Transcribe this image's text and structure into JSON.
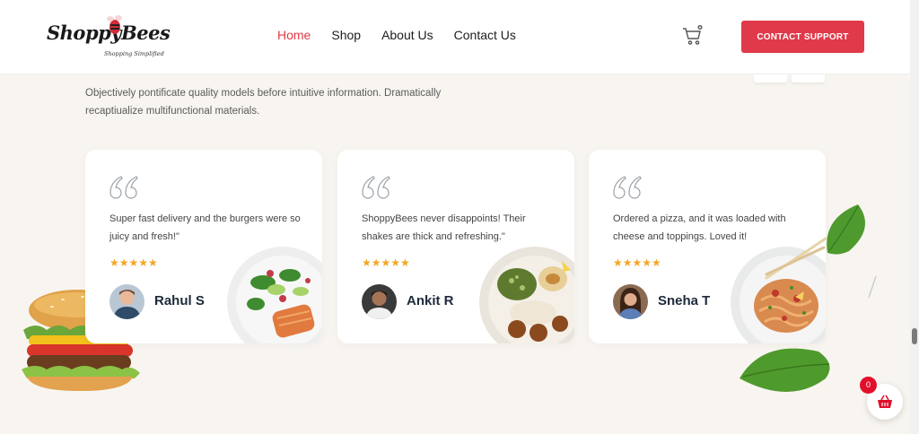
{
  "logo": {
    "name": "ShoppyBees",
    "tagline": "Shopping Simplified"
  },
  "nav": {
    "items": [
      {
        "label": "Home",
        "active": true
      },
      {
        "label": "Shop",
        "active": false
      },
      {
        "label": "About Us",
        "active": false
      },
      {
        "label": "Contact Us",
        "active": false
      }
    ]
  },
  "header": {
    "cart_icon": "cart-icon",
    "support_label": "CONTACT SUPPORT"
  },
  "intro": {
    "text": "Objectively pontificate quality models before intuitive information. Dramatically recaptiualize multifunctional materials."
  },
  "testimonials": [
    {
      "review": "Super fast delivery and the burgers were so juicy and fresh!\"",
      "stars": "★★★★★",
      "rating": 5,
      "name": "Rahul S",
      "dish": "salad-salmon-plate"
    },
    {
      "review": "ShoppyBees never disappoints! Their shakes are thick and refreshing.\"",
      "stars": "★★★★★",
      "rating": 5,
      "name": "Ankit R",
      "dish": "falafel-plate"
    },
    {
      "review": "Ordered a pizza, and it was loaded with cheese and toppings. Loved it!",
      "stars": "★★★★★",
      "rating": 5,
      "name": "Sneha T",
      "dish": "noodles-plate"
    }
  ],
  "basket": {
    "count": "0"
  },
  "colors": {
    "accent": "#e0394a",
    "star": "#f5a623",
    "background": "#f8f5f0"
  }
}
